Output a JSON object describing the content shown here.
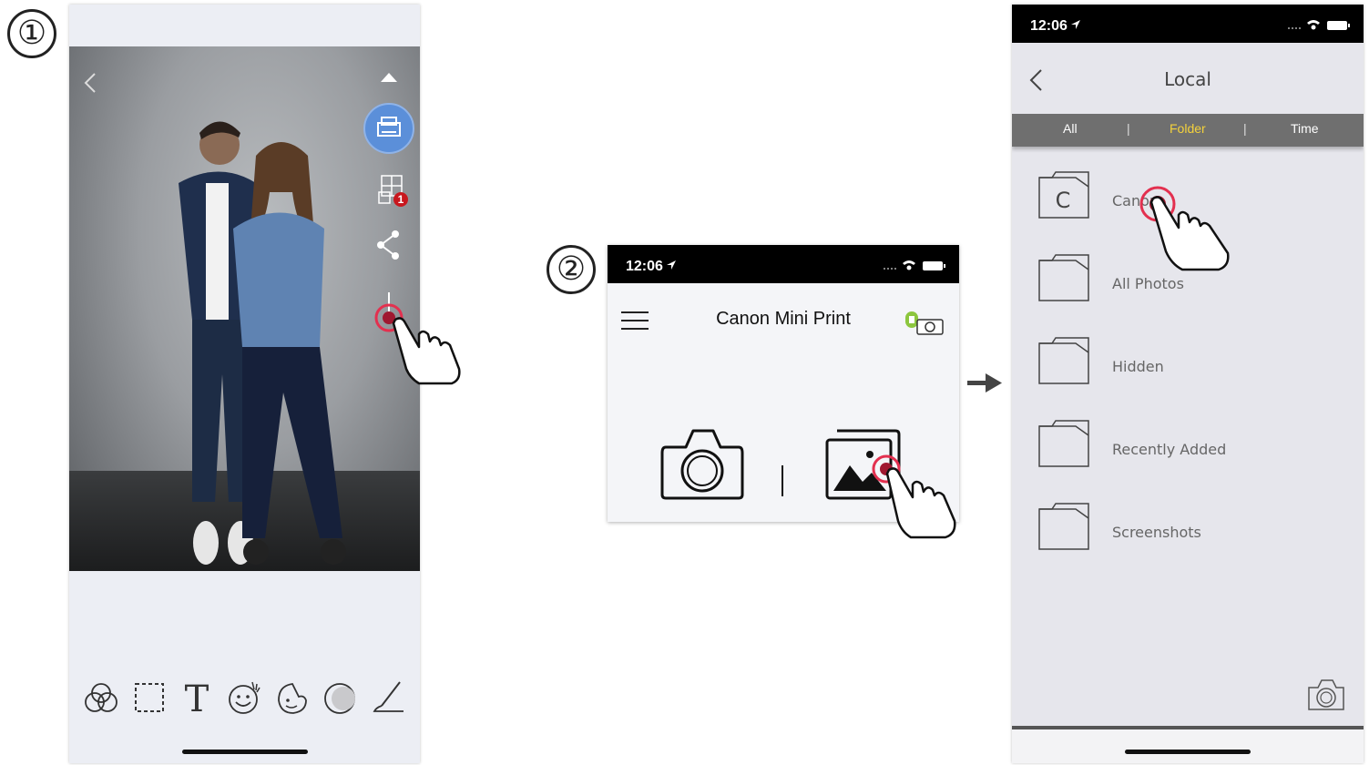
{
  "steps": {
    "step1": "①",
    "step2": "②"
  },
  "screen2": {
    "status_time": "12:06",
    "title": "Canon Mini Print"
  },
  "screen3": {
    "status_time": "12:06",
    "nav_title": "Local",
    "segments": {
      "all": "All",
      "folder": "Folder",
      "time": "Time",
      "sep": "|"
    },
    "folders": [
      {
        "label": "Canon",
        "letter": "C"
      },
      {
        "label": "All Photos"
      },
      {
        "label": "Hidden"
      },
      {
        "label": "Recently Added"
      },
      {
        "label": "Screenshots"
      }
    ]
  },
  "screen1": {
    "badge_count": "1"
  },
  "colors": {
    "accent_blue": "#5b8fd9",
    "badge_red": "#c8171e",
    "segment_active": "#f4d23c",
    "segment_bar": "#6f6f6f",
    "tap_ring": "#e3304f"
  },
  "icons": [
    "back-chevron-icon",
    "collapse-arrow-icon",
    "print-icon",
    "collage-icon",
    "share-icon",
    "save-icon",
    "filter-icon",
    "frame-icon",
    "text-icon",
    "sticker-icon",
    "beauty-icon",
    "adjust-icon",
    "draw-icon",
    "menu-icon",
    "printer-battery-icon",
    "camera-icon",
    "gallery-icon",
    "folder-icon",
    "hand-pointer-icon"
  ]
}
